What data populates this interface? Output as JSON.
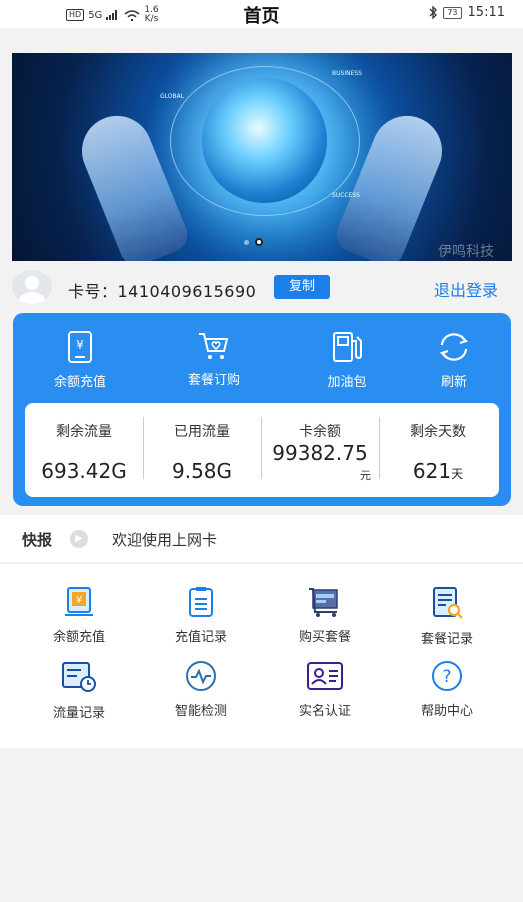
{
  "status_bar": {
    "network": "HD",
    "signal": "5G",
    "speed": "1.6",
    "speed_unit": "K/s",
    "battery": "73",
    "time": "15:11"
  },
  "header": {
    "title": "首页"
  },
  "banner": {
    "labels": [
      "GLOBAL",
      "BUSINESS",
      "SUCCESS"
    ],
    "watermark": "伊鸣科技",
    "current_slide": 2,
    "total_slides": 2
  },
  "card": {
    "card_label": "卡号：1410409615690",
    "copy_label": "复制",
    "logout_label": "退出登录"
  },
  "quick_actions": [
    {
      "label": "余额充值",
      "icon": "phone-yuan-icon"
    },
    {
      "label": "套餐订购",
      "icon": "cart-heart-icon"
    },
    {
      "label": "加油包",
      "icon": "fuel-icon"
    },
    {
      "label": "刷新",
      "icon": "refresh-icon"
    }
  ],
  "stats": [
    {
      "label": "剩余流量",
      "value": "693.42G",
      "unit": ""
    },
    {
      "label": "已用流量",
      "value": "9.58G",
      "unit": ""
    },
    {
      "label": "卡余额",
      "value": "99382.75",
      "unit": "元"
    },
    {
      "label": "剩余天数",
      "value": "621",
      "unit": "天"
    }
  ],
  "news": {
    "tag": "快报",
    "text": "欢迎使用上网卡"
  },
  "grid": [
    {
      "label": "余额充值",
      "icon": "recharge-icon"
    },
    {
      "label": "充值记录",
      "icon": "recharge-record-icon"
    },
    {
      "label": "购买套餐",
      "icon": "buy-package-icon"
    },
    {
      "label": "套餐记录",
      "icon": "package-record-icon"
    },
    {
      "label": "流量记录",
      "icon": "traffic-record-icon"
    },
    {
      "label": "智能检测",
      "icon": "smart-detect-icon"
    },
    {
      "label": "实名认证",
      "icon": "id-verify-icon"
    },
    {
      "label": "帮助中心",
      "icon": "help-icon"
    }
  ],
  "colors": {
    "primary": "#2a8ef0",
    "accent_blue": "#1a7fe8",
    "orange": "#f5a623"
  }
}
